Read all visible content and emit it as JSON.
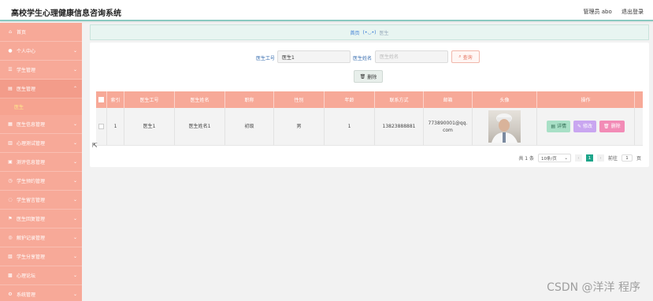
{
  "header": {
    "title": "高校学生心理健康信息咨询系统",
    "user": "管理员 abo",
    "logout": "退出登录"
  },
  "sidebar": {
    "items": [
      {
        "label": "首页",
        "icon": "home-icon",
        "glyph": "⌂",
        "chevron": false
      },
      {
        "label": "个人中心",
        "icon": "user-icon",
        "glyph": "●",
        "chevron": true
      },
      {
        "label": "学生管理",
        "icon": "list-icon",
        "glyph": "☰",
        "chevron": true
      },
      {
        "label": "医生管理",
        "icon": "doctor-icon",
        "glyph": "▤",
        "chevron": true,
        "open": true,
        "sub": "医生"
      },
      {
        "label": "医生信息管理",
        "icon": "info-icon",
        "glyph": "▦",
        "chevron": true
      },
      {
        "label": "心理测试管理",
        "icon": "chart-icon",
        "glyph": "▥",
        "chevron": true
      },
      {
        "label": "测评信息管理",
        "icon": "form-icon",
        "glyph": "▣",
        "chevron": true
      },
      {
        "label": "学生预约管理",
        "icon": "calendar-icon",
        "glyph": "◷",
        "chevron": true
      },
      {
        "label": "学生留言管理",
        "icon": "message-icon",
        "glyph": "◌",
        "chevron": true
      },
      {
        "label": "医生回复管理",
        "icon": "flag-icon",
        "glyph": "⚑",
        "chevron": true
      },
      {
        "label": "解护记录管理",
        "icon": "record-icon",
        "glyph": "◎",
        "chevron": true
      },
      {
        "label": "学生分享管理",
        "icon": "share-icon",
        "glyph": "▧",
        "chevron": true
      },
      {
        "label": "心理论坛",
        "icon": "forum-icon",
        "glyph": "▩",
        "chevron": true
      },
      {
        "label": "系统管理",
        "icon": "settings-icon",
        "glyph": "⚙",
        "chevron": true
      }
    ]
  },
  "breadcrumb": {
    "home": "首页",
    "current": "医生"
  },
  "search": {
    "id_label": "医生工号",
    "id_value": "医生1",
    "name_label": "医生姓名",
    "name_placeholder": "医生姓名",
    "query_label": "查询",
    "delete_label": "删除"
  },
  "table": {
    "columns": [
      "索引",
      "医生工号",
      "医生姓名",
      "职称",
      "性别",
      "年龄",
      "联系方式",
      "邮箱",
      "头像",
      "操作"
    ],
    "rows": [
      {
        "index": "1",
        "doctor_id": "医生1",
        "doctor_name": "医生姓名1",
        "title": "初级",
        "gender": "男",
        "age": "1",
        "phone": "13823888881",
        "email": "773890001@qq.com",
        "detail": "详情",
        "edit": "修改",
        "delete": "删除"
      }
    ]
  },
  "pager": {
    "total": "共 1 条",
    "page_size": "10条/页",
    "current_page": "1",
    "goto_label": "前往",
    "goto_value": "1",
    "page_unit": "页"
  },
  "watermark": "CSDN @洋洋 程序",
  "colors": {
    "sidebar": "#f7a998",
    "header_accent": "#89c9c0",
    "pager_active": "#1ea58a"
  }
}
